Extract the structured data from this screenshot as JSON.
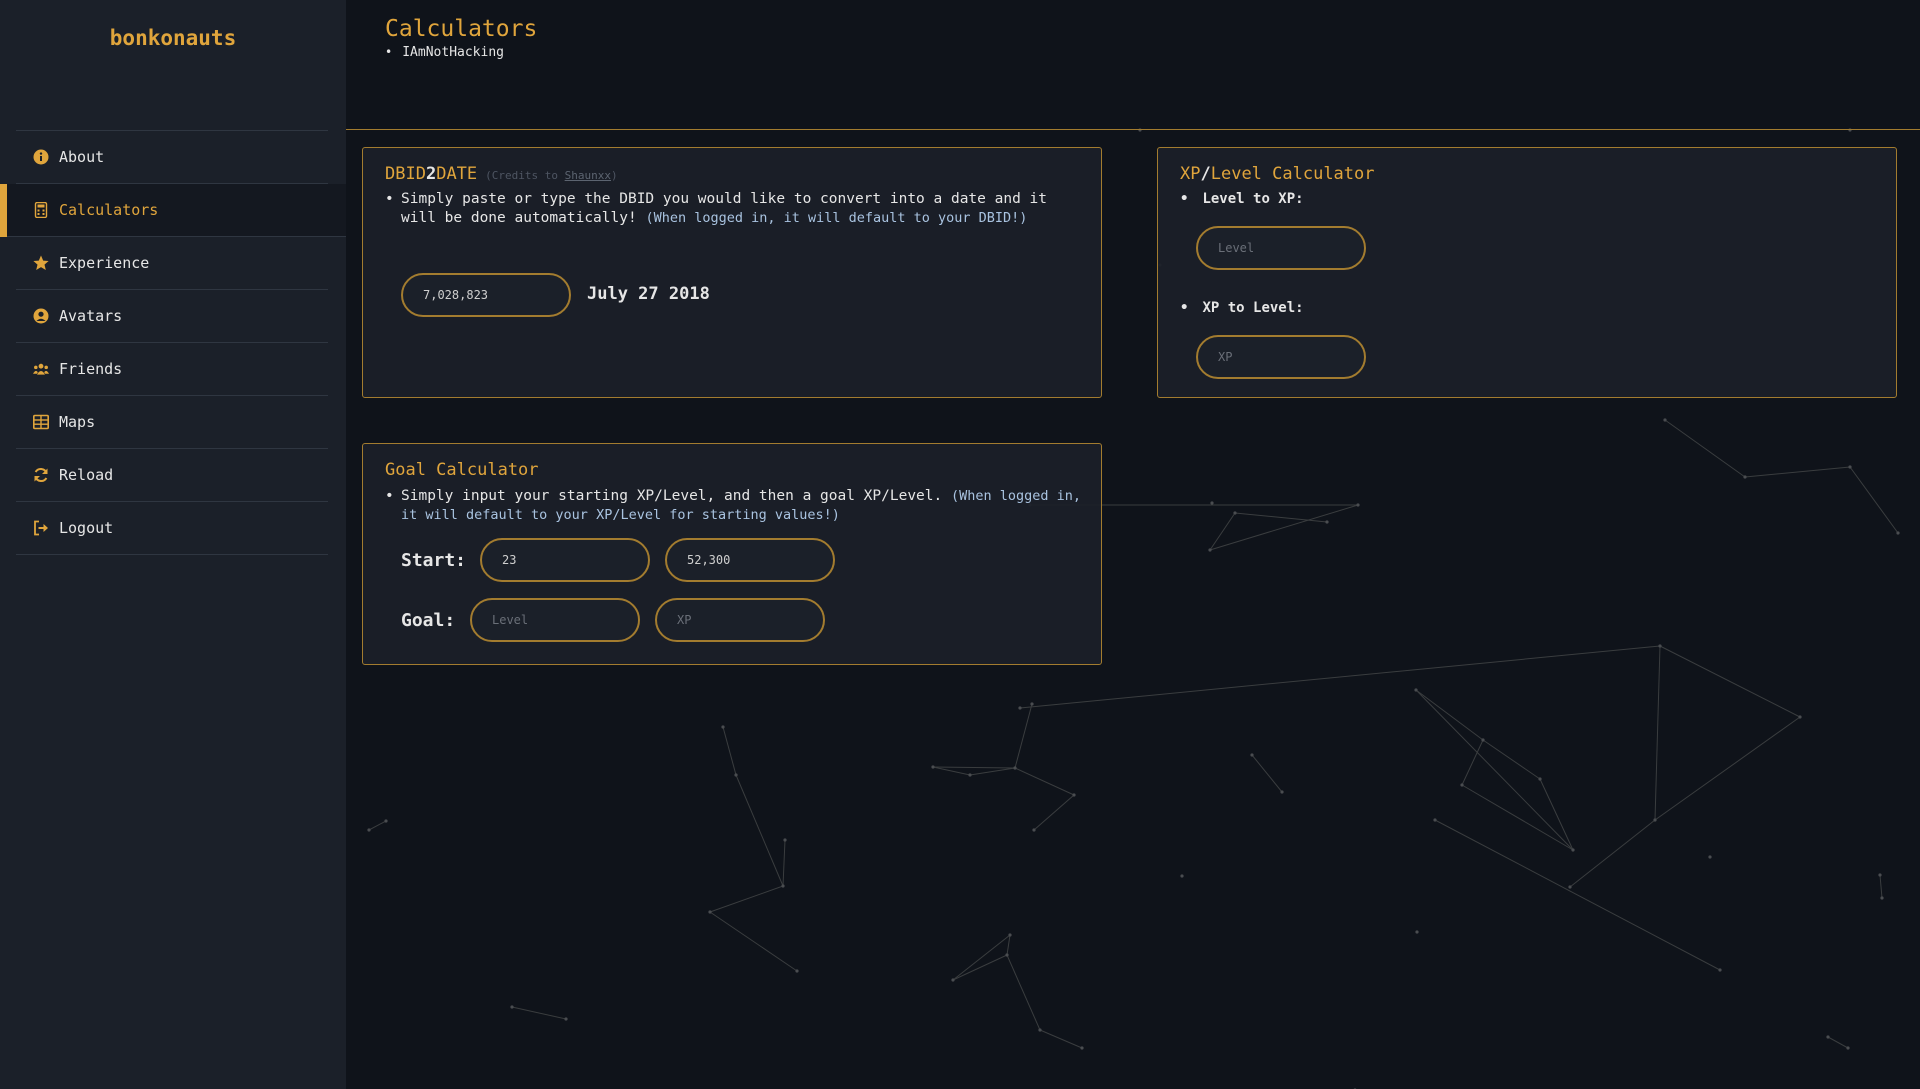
{
  "brand": "bonkonauts",
  "sidebar": {
    "items": [
      {
        "label": "About",
        "icon": "info-icon"
      },
      {
        "label": "Calculators",
        "icon": "calculator-icon",
        "active": true
      },
      {
        "label": "Experience",
        "icon": "star-icon"
      },
      {
        "label": "Avatars",
        "icon": "user-icon"
      },
      {
        "label": "Friends",
        "icon": "users-icon"
      },
      {
        "label": "Maps",
        "icon": "table-icon"
      },
      {
        "label": "Reload",
        "icon": "refresh-icon"
      },
      {
        "label": "Logout",
        "icon": "logout-icon"
      }
    ]
  },
  "page": {
    "title": "Calculators",
    "users": [
      "IAmNotHacking"
    ]
  },
  "dbid": {
    "title_a": "DBID",
    "title_b": "2",
    "title_c": "DATE",
    "credits_prefix": "(Credits to ",
    "credits_name": "Shaunxx",
    "credits_suffix": ")",
    "desc": "Simply paste or type the DBID you would like to convert into a date and it will be done automatically!",
    "note": "(When logged in, it will default to your DBID!)",
    "input_value": "7,028,823",
    "result": "July 27 2018"
  },
  "xp": {
    "title_a": "XP",
    "title_b": "/",
    "title_c": "Level Calculator",
    "level_to_xp_label": "Level to XP:",
    "level_placeholder": "Level",
    "xp_to_level_label": "XP to Level:",
    "xp_placeholder": "XP"
  },
  "goal": {
    "title": "Goal Calculator",
    "desc": "Simply input your starting XP/Level, and then a goal XP/Level.",
    "note": "(When logged in, it will default to your XP/Level for starting values!)",
    "start_label": "Start:",
    "start_level": "23",
    "start_xp": "52,300",
    "goal_label": "Goal:",
    "goal_level_placeholder": "Level",
    "goal_xp_placeholder": "XP"
  },
  "colors": {
    "accent": "#e0a53c",
    "sidebar_bg": "#1b2029",
    "page_bg": "#0f131a",
    "note": "#a9c3e0"
  }
}
